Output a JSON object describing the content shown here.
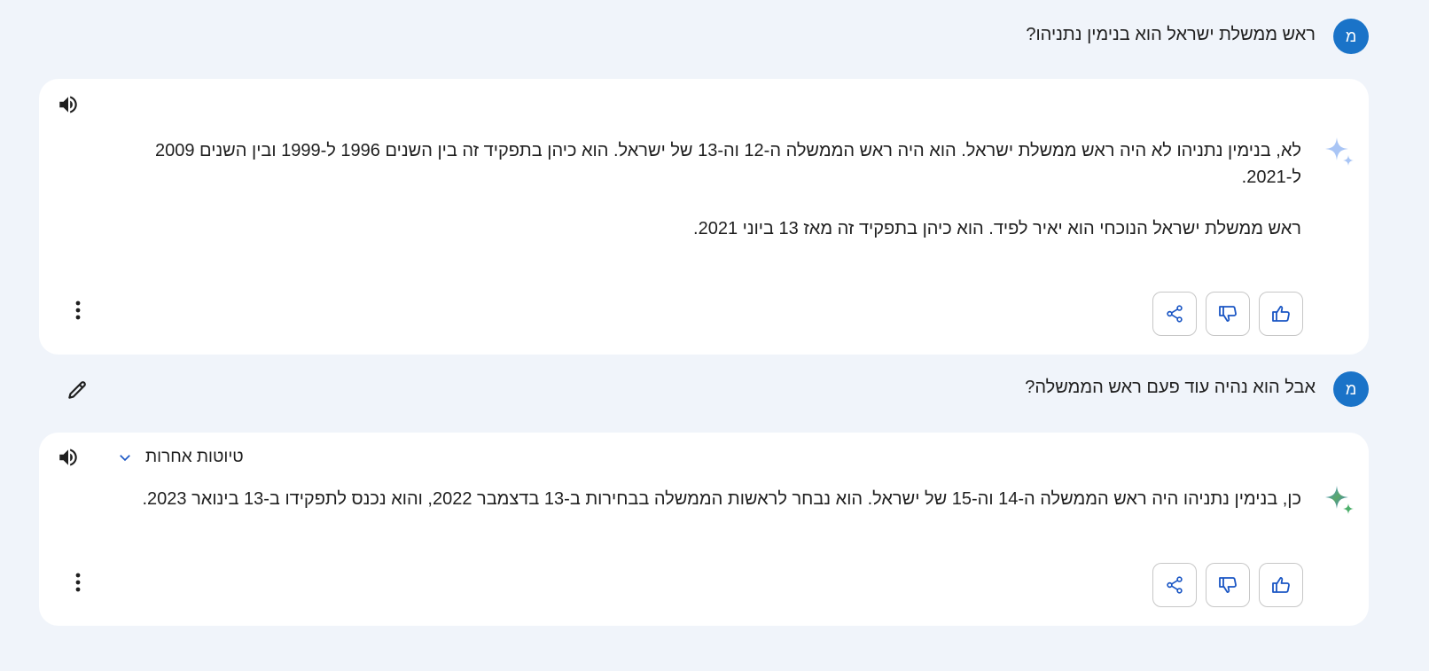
{
  "conversation": {
    "avatar_letter": "מ",
    "user_messages": [
      {
        "text": "ראש ממשלת ישראל הוא בנימין נתניהו?"
      },
      {
        "text": "אבל הוא נהיה עוד פעם ראש הממשלה?"
      }
    ],
    "responses": [
      {
        "paragraphs": [
          "לא, בנימין נתניהו לא היה ראש ממשלת ישראל. הוא היה ראש הממשלה ה-12 וה-13 של ישראל. הוא כיהן בתפקיד זה בין השנים 1996 ל-1999 ובין השנים 2009 ל-2021.",
          "ראש ממשלת ישראל הנוכחי הוא יאיר לפיד. הוא כיהן בתפקיד זה מאז 13 ביוני 2021."
        ]
      },
      {
        "drafts_label": "טיוטות אחרות",
        "paragraphs": [
          "כן, בנימין נתניהו היה ראש הממשלה ה-14 וה-15 של ישראל. הוא נבחר לראשות הממשלה בבחירות ב-13 בדצמבר 2022, והוא נכנס לתפקידו ב-13 בינואר 2023."
        ]
      }
    ]
  },
  "icons": {
    "speaker": "volume-icon",
    "edit": "pencil-icon",
    "more": "more-vert-icon",
    "share": "share-icon",
    "thumbs_down": "thumbs-down-icon",
    "thumbs_up": "thumbs-up-icon",
    "sparkle": "gemini-sparkle-icon",
    "chevron": "chevron-down-icon"
  },
  "colors": {
    "background": "#f0f4fa",
    "card": "#ffffff",
    "avatar": "#1a73c8",
    "accent_icon": "#1a56c4",
    "sparkle_light": "#a9c5f5"
  }
}
